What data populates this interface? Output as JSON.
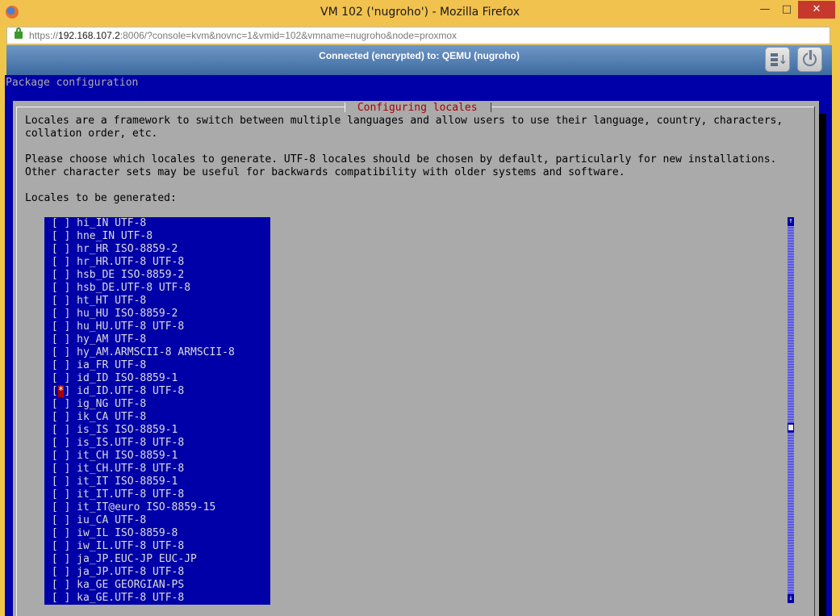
{
  "window": {
    "title": "VM 102 ('nugroho') - Mozilla Firefox",
    "icon": "firefox-icon",
    "controls": {
      "minimize": "—",
      "maximize": "□",
      "close": "✕"
    }
  },
  "urlbar": {
    "prefix": "https://",
    "host": "192.168.107.2",
    "rest": ":8006/?console=kvm&novnc=1&vmid=102&vmname=nugroho&node=proxmox"
  },
  "novnc": {
    "status": "Connected (encrypted) to: QEMU (nugroho)",
    "buttons": [
      "keyboard-icon",
      "power-icon"
    ]
  },
  "terminal": {
    "backtitle": "Package configuration",
    "dialog_title": " Configuring locales ",
    "description": "Locales are a framework to switch between multiple languages and allow users to use their language, country, characters,\ncollation order, etc.\n\nPlease choose which locales to generate. UTF-8 locales should be chosen by default, particularly for new installations.\nOther character sets may be useful for backwards compatibility with older systems and software.\n\nLocales to be generated:",
    "locales": [
      {
        "label": "hi_IN UTF-8",
        "checked": false
      },
      {
        "label": "hne_IN UTF-8",
        "checked": false
      },
      {
        "label": "hr_HR ISO-8859-2",
        "checked": false
      },
      {
        "label": "hr_HR.UTF-8 UTF-8",
        "checked": false
      },
      {
        "label": "hsb_DE ISO-8859-2",
        "checked": false
      },
      {
        "label": "hsb_DE.UTF-8 UTF-8",
        "checked": false
      },
      {
        "label": "ht_HT UTF-8",
        "checked": false
      },
      {
        "label": "hu_HU ISO-8859-2",
        "checked": false
      },
      {
        "label": "hu_HU.UTF-8 UTF-8",
        "checked": false
      },
      {
        "label": "hy_AM UTF-8",
        "checked": false
      },
      {
        "label": "hy_AM.ARMSCII-8 ARMSCII-8",
        "checked": false
      },
      {
        "label": "ia_FR UTF-8",
        "checked": false
      },
      {
        "label": "id_ID ISO-8859-1",
        "checked": false
      },
      {
        "label": "id_ID.UTF-8 UTF-8",
        "checked": true
      },
      {
        "label": "ig_NG UTF-8",
        "checked": false
      },
      {
        "label": "ik_CA UTF-8",
        "checked": false
      },
      {
        "label": "is_IS ISO-8859-1",
        "checked": false
      },
      {
        "label": "is_IS.UTF-8 UTF-8",
        "checked": false
      },
      {
        "label": "it_CH ISO-8859-1",
        "checked": false
      },
      {
        "label": "it_CH.UTF-8 UTF-8",
        "checked": false
      },
      {
        "label": "it_IT ISO-8859-1",
        "checked": false
      },
      {
        "label": "it_IT.UTF-8 UTF-8",
        "checked": false
      },
      {
        "label": "it_IT@euro ISO-8859-15",
        "checked": false
      },
      {
        "label": "iu_CA UTF-8",
        "checked": false
      },
      {
        "label": "iw_IL ISO-8859-8",
        "checked": false
      },
      {
        "label": "iw_IL.UTF-8 UTF-8",
        "checked": false
      },
      {
        "label": "ja_JP.EUC-JP EUC-JP",
        "checked": false
      },
      {
        "label": "ja_JP.UTF-8 UTF-8",
        "checked": false
      },
      {
        "label": "ka_GE GEORGIAN-PS",
        "checked": false
      },
      {
        "label": "ka_GE.UTF-8 UTF-8",
        "checked": false
      }
    ],
    "scrollbar": {
      "up": "↑",
      "down": "↓",
      "position": 0.55
    },
    "colors": {
      "screen": "#0000a8",
      "dialog": "#aaaaaa",
      "title": "#a80000",
      "mark": "#aa0000"
    }
  }
}
